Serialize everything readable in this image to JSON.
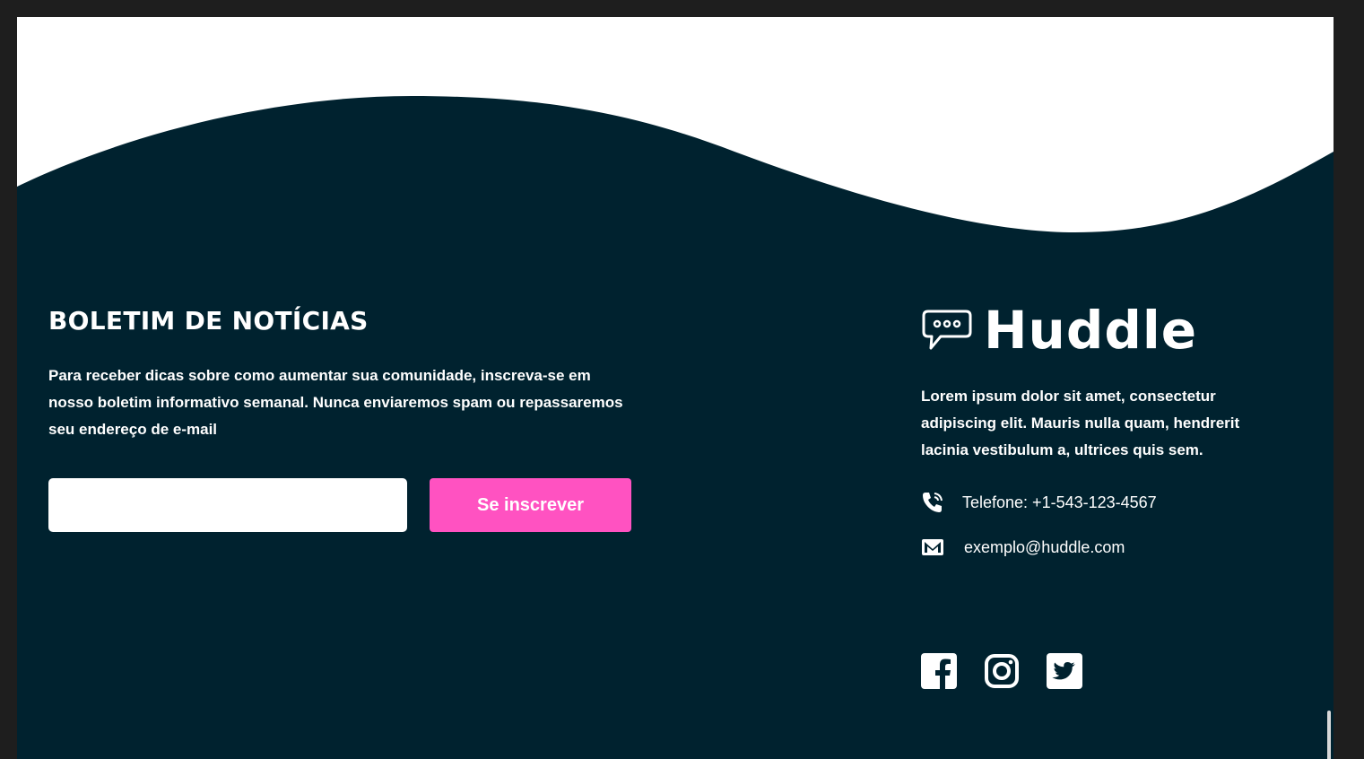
{
  "newsletter": {
    "title": "BOLETIM DE NOTÍCIAS",
    "description": "Para receber dicas sobre como aumentar sua comunidade, inscreva-se em nosso boletim informativo semanal. Nunca enviaremos spam ou repassaremos seu endereço de e-mail",
    "email_value": "",
    "button_label": "Se inscrever"
  },
  "brand": {
    "name": "Huddle",
    "logo_icon": "chat-bubble-icon",
    "description": "Lorem ipsum dolor sit amet, consectetur adipiscing elit. Mauris nulla quam, hendrerit lacinia vestibulum a, ultrices quis sem."
  },
  "contact": {
    "phone": "Telefone: +1-543-123-4567",
    "phone_icon": "phone-icon",
    "email": "exemplo@huddle.com",
    "email_icon": "email-icon"
  },
  "social": [
    {
      "icon": "facebook-icon"
    },
    {
      "icon": "instagram-icon"
    },
    {
      "icon": "twitter-icon"
    }
  ],
  "colors": {
    "footer_bg": "#00222f",
    "accent": "#ff52c1",
    "page_bg": "#ffffff",
    "window_frame": "#1e1e1e"
  }
}
